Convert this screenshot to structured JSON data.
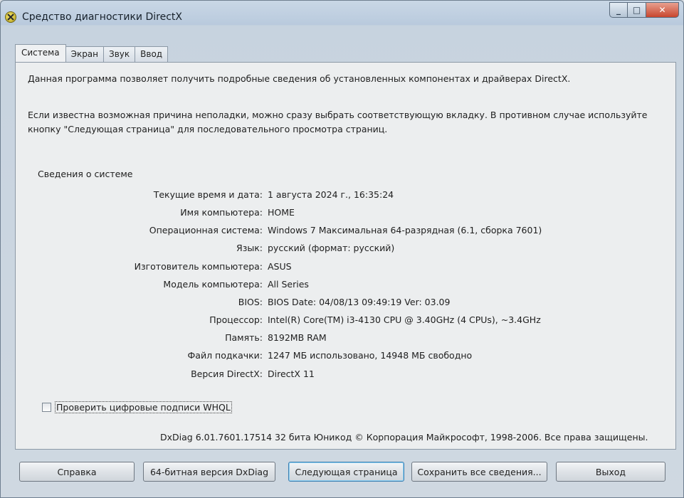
{
  "window": {
    "title": "Средство диагностики DirectX",
    "caption": {
      "minimize": "_",
      "maximize": "□",
      "close": "✕"
    }
  },
  "tabs": [
    "Система",
    "Экран",
    "Звук",
    "Ввод"
  ],
  "active_tab": "Система",
  "intro": {
    "line1": "Данная программа позволяет получить подробные сведения об установленных компонентах и драйверах DirectX.",
    "line2": "Если известна возможная причина неполадки, можно сразу выбрать соответствующую вкладку. В противном случае используйте кнопку \"Следующая страница\" для последовательного просмотра страниц."
  },
  "system_info": {
    "group_title": "Сведения о системе",
    "rows": [
      {
        "label": "Текущие время и дата:",
        "value": "1 августа 2024 г., 16:35:24"
      },
      {
        "label": "Имя компьютера:",
        "value": "HOME"
      },
      {
        "label": "Операционная система:",
        "value": "Windows 7 Максимальная 64-разрядная (6.1, сборка 7601)"
      },
      {
        "label": "Язык:",
        "value": "русский (формат: русский)"
      },
      {
        "label": "Изготовитель компьютера:",
        "value": "ASUS"
      },
      {
        "label": "Модель компьютера:",
        "value": "All Series"
      },
      {
        "label": "BIOS:",
        "value": "BIOS Date: 04/08/13 09:49:19 Ver: 03.09"
      },
      {
        "label": "Процессор:",
        "value": "Intel(R) Core(TM) i3-4130 CPU @ 3.40GHz (4 CPUs), ~3.4GHz"
      },
      {
        "label": "Память:",
        "value": "8192MB RAM"
      },
      {
        "label": "Файл подкачки:",
        "value": "1247 МБ использовано, 14948 МБ свободно"
      },
      {
        "label": "Версия DirectX:",
        "value": "DirectX 11"
      }
    ]
  },
  "whql_checkbox": {
    "label": "Проверить цифровые подписи WHQL",
    "checked": false
  },
  "footer": "DxDiag 6.01.7601.17514 32 бита Юникод  © Корпорация Майкрософт, 1998-2006.  Все права защищены.",
  "buttons": {
    "help": "Справка",
    "dxdiag64": "64-битная версия DxDiag",
    "next_page": "Следующая страница",
    "save_all": "Сохранить все сведения...",
    "exit": "Выход"
  }
}
